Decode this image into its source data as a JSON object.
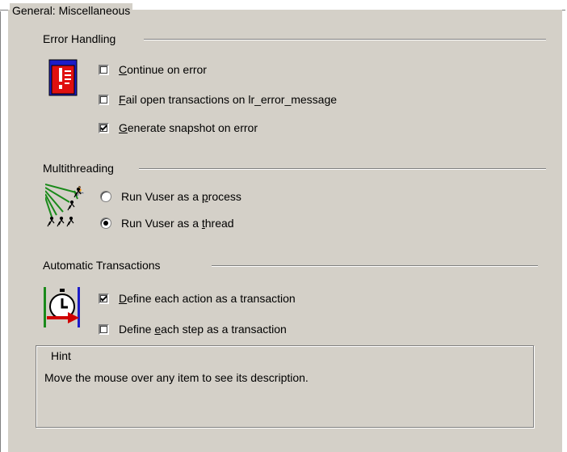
{
  "general": {
    "title": "General: Miscellaneous"
  },
  "error_handling": {
    "title": "Error Handling",
    "items": [
      {
        "pre": "",
        "ul": "C",
        "post": "ontinue on error",
        "checked": false
      },
      {
        "pre": "",
        "ul": "F",
        "post": "ail open transactions on lr_error_message",
        "checked": false
      },
      {
        "pre": "",
        "ul": "G",
        "post": "enerate snapshot on error",
        "checked": true
      }
    ]
  },
  "multithreading": {
    "title": "Multithreading",
    "items": [
      {
        "pre": "Run Vuser as a ",
        "ul": "p",
        "post": "rocess",
        "selected": false
      },
      {
        "pre": "Run Vuser as a ",
        "ul": "t",
        "post": "hread",
        "selected": true
      }
    ]
  },
  "automatic_transactions": {
    "title": "Automatic Transactions",
    "items": [
      {
        "pre": "",
        "ul": "D",
        "post": "efine each action as a transaction",
        "checked": true
      },
      {
        "pre": "Define ",
        "ul": "e",
        "post": "ach step as a transaction",
        "checked": false
      }
    ]
  },
  "hint": {
    "title": "Hint",
    "text": "Move the mouse over any item to see its description."
  },
  "icons": {
    "error_handling": "error-document-icon",
    "multithreading": "runner-threads-icon",
    "automatic_transactions": "stopwatch-arrow-icon"
  },
  "colors": {
    "panel": "#d4d0c8",
    "error_red": "#e01010",
    "thread_green": "#1a8a1a",
    "arrow_red": "#d00000"
  }
}
